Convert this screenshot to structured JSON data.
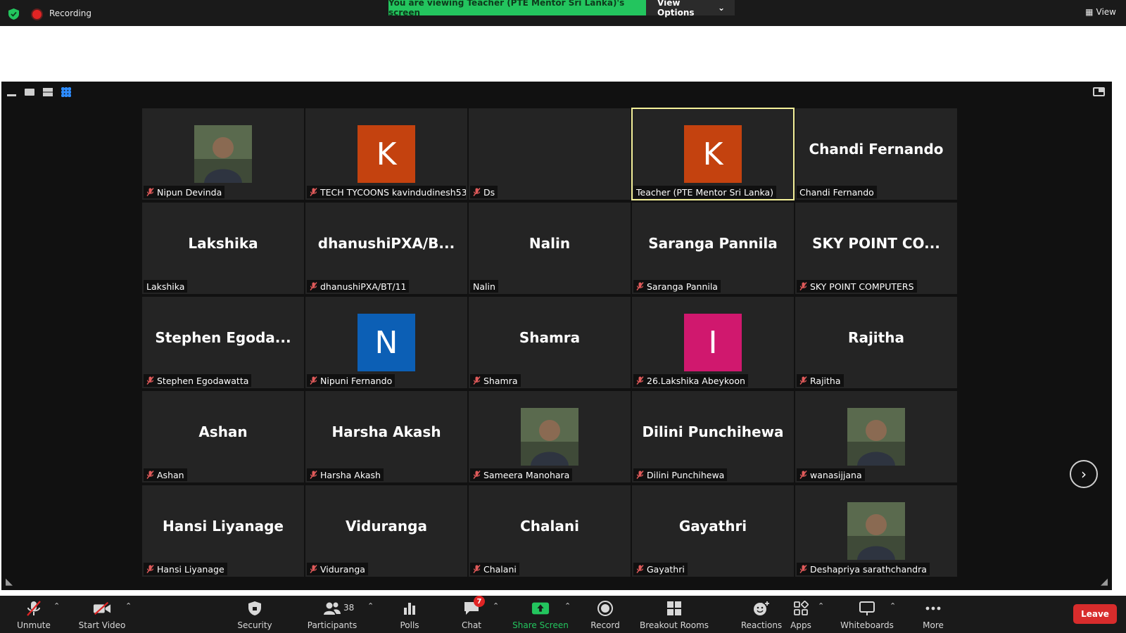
{
  "top_bar": {
    "recording_label": "Recording",
    "viewing_banner": "You are viewing Teacher (PTE Mentor Sri Lanka)'s screen",
    "view_options_label": "View Options",
    "view_label": "View"
  },
  "stage": {
    "next_page_icon": "chevron-right-icon"
  },
  "participants": [
    {
      "display": "photo",
      "label": "Nipun Devinda",
      "muted": true
    },
    {
      "display": "avatar",
      "initial": "K",
      "color": "#c4420f",
      "label": "TECH TYCOONS kavindudinesh53...",
      "muted": true
    },
    {
      "display": "blank",
      "label": "Ds",
      "muted": true
    },
    {
      "display": "avatar",
      "initial": "K",
      "color": "#c4420f",
      "label": "Teacher (PTE Mentor Sri Lanka)",
      "muted": false,
      "active_speaker": true
    },
    {
      "display": "name",
      "big_name": "Chandi Fernando",
      "label": "Chandi Fernando",
      "muted": false
    },
    {
      "display": "name",
      "big_name": "Lakshika",
      "label": "Lakshika",
      "muted": false
    },
    {
      "display": "name",
      "big_name": "dhanushiPXA/B...",
      "label": "dhanushiPXA/BT/11",
      "muted": true
    },
    {
      "display": "name",
      "big_name": "Nalin",
      "label": "Nalin",
      "muted": false
    },
    {
      "display": "name",
      "big_name": "Saranga Pannila",
      "label": "Saranga Pannila",
      "muted": true
    },
    {
      "display": "name",
      "big_name": "SKY POINT CO...",
      "label": "SKY POINT COMPUTERS",
      "muted": true
    },
    {
      "display": "name",
      "big_name": "Stephen Egoda...",
      "label": "Stephen Egodawatta",
      "muted": true
    },
    {
      "display": "avatar",
      "initial": "N",
      "color": "#0c5fb5",
      "label": "Nipuni Fernando",
      "muted": true
    },
    {
      "display": "name",
      "big_name": "Shamra",
      "label": "Shamra",
      "muted": true
    },
    {
      "display": "avatar",
      "initial": "I",
      "color": "#d0186e",
      "label": "26.Lakshika Abeykoon",
      "muted": true
    },
    {
      "display": "name",
      "big_name": "Rajitha",
      "label": "Rajitha",
      "muted": true
    },
    {
      "display": "name",
      "big_name": "Ashan",
      "label": "Ashan",
      "muted": true
    },
    {
      "display": "name",
      "big_name": "Harsha Akash",
      "label": "Harsha Akash",
      "muted": true
    },
    {
      "display": "photo",
      "label": "Sameera Manohara",
      "muted": true
    },
    {
      "display": "name",
      "big_name": "Dilini Punchihewa",
      "label": "Dilini Punchihewa",
      "muted": true
    },
    {
      "display": "photo",
      "label": "wanasijjana",
      "muted": true
    },
    {
      "display": "name",
      "big_name": "Hansi Liyanage",
      "label": "Hansi Liyanage",
      "muted": true
    },
    {
      "display": "name",
      "big_name": "Viduranga",
      "label": "Viduranga",
      "muted": true
    },
    {
      "display": "name",
      "big_name": "Chalani",
      "label": "Chalani",
      "muted": true
    },
    {
      "display": "name",
      "big_name": "Gayathri",
      "label": "Gayathri",
      "muted": true
    },
    {
      "display": "photo",
      "label": "Deshapriya sarathchandra",
      "muted": true
    }
  ],
  "toolbar": {
    "unmute": "Unmute",
    "start_video": "Start Video",
    "security": "Security",
    "participants": "Participants",
    "participants_count": "38",
    "polls": "Polls",
    "chat": "Chat",
    "chat_badge": "7",
    "share_screen": "Share Screen",
    "record": "Record",
    "breakout_rooms": "Breakout Rooms",
    "reactions": "Reactions",
    "apps": "Apps",
    "whiteboards": "Whiteboards",
    "more": "More",
    "leave": "Leave"
  },
  "colors": {
    "accent_green": "#23c55e",
    "active_speaker": "#f5f19a",
    "leave_red": "#d82c2c"
  }
}
